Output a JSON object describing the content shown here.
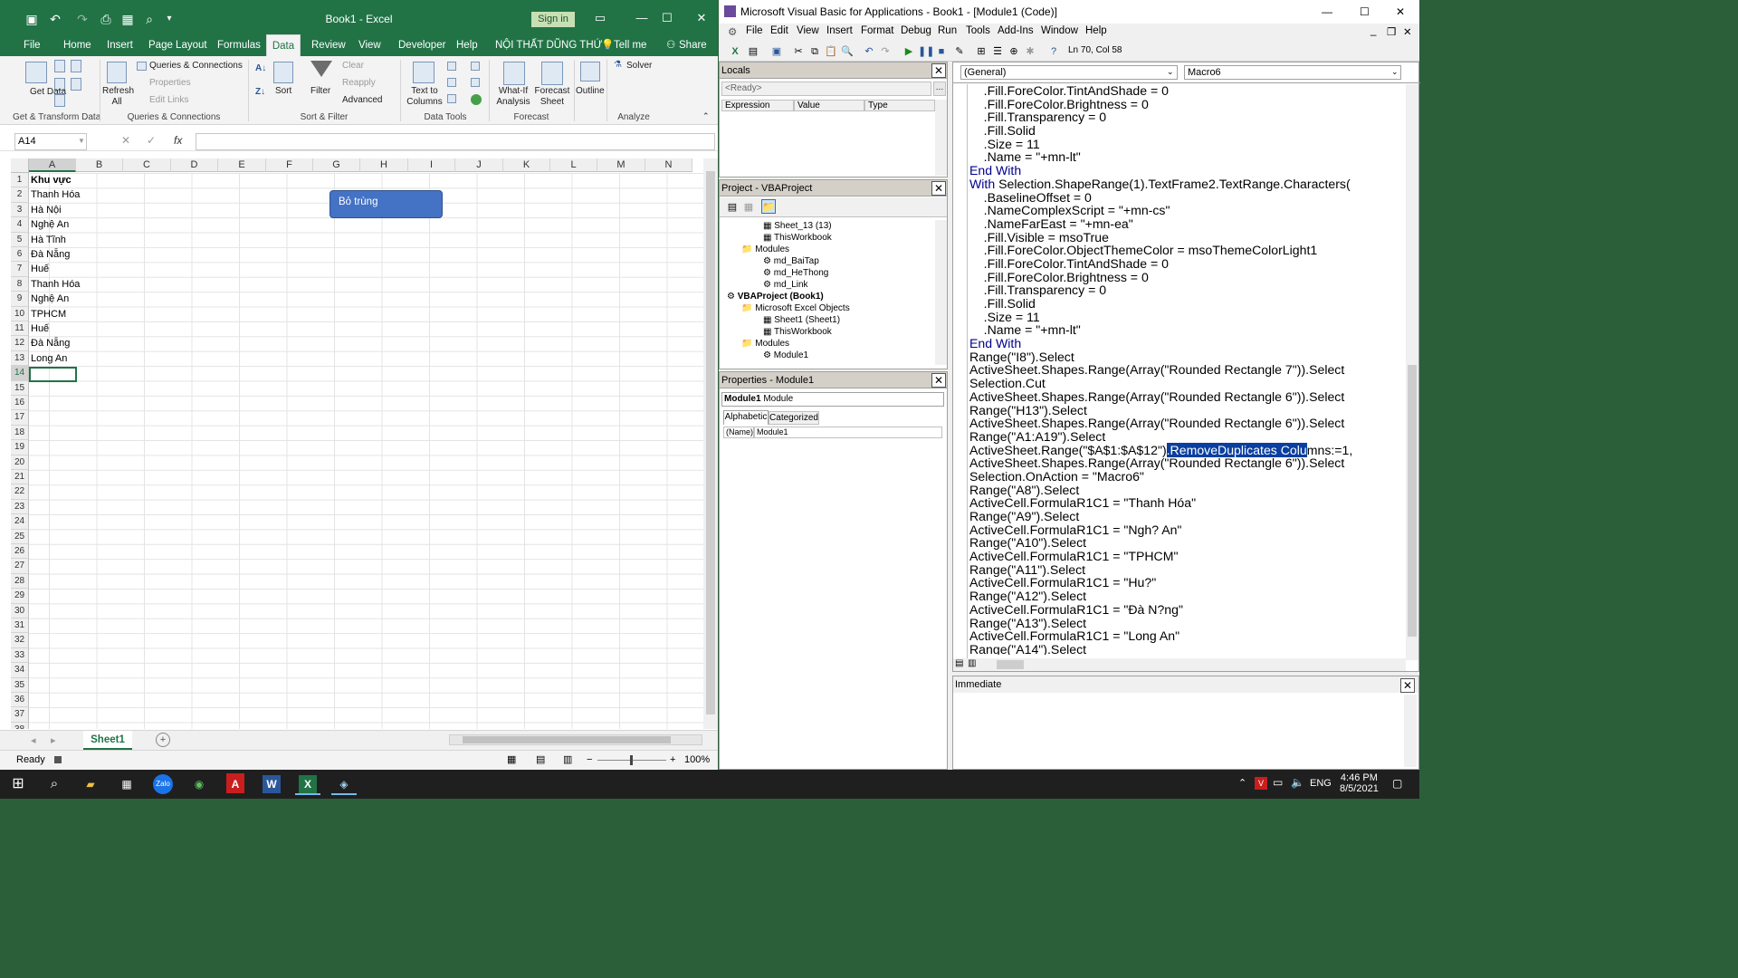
{
  "excel": {
    "title": "Book1  -  Excel",
    "signin": "Sign in",
    "tabs": [
      "File",
      "Home",
      "Insert",
      "Page Layout",
      "Formulas",
      "Data",
      "Review",
      "View",
      "Developer",
      "Help",
      "NỘI THẤT DŨNG THỨ"
    ],
    "tell_me": "Tell me",
    "share": "Share",
    "ribbon": {
      "get_data": "Get Data",
      "get_transform": "Get & Transform Data",
      "queries_connections": "Queries & Connections",
      "properties": "Properties",
      "edit_links": "Edit Links",
      "refresh_all": "Refresh All",
      "qc_group": "Queries & Connections",
      "sort": "Sort",
      "filter": "Filter",
      "clear": "Clear",
      "reapply": "Reapply",
      "advanced": "Advanced",
      "sort_filter": "Sort & Filter",
      "text_to_columns": "Text to Columns",
      "data_tools": "Data Tools",
      "what_if": "What-If Analysis",
      "forecast_sheet": "Forecast Sheet",
      "forecast": "Forecast",
      "outline": "Outline",
      "solver": "Solver",
      "analyze": "Analyze"
    },
    "name_box": "A14",
    "columns": [
      "A",
      "B",
      "C",
      "D",
      "E",
      "F",
      "G",
      "H",
      "I",
      "J",
      "K",
      "L",
      "M",
      "N"
    ],
    "rows": [
      "1",
      "2",
      "3",
      "4",
      "5",
      "6",
      "7",
      "8",
      "9",
      "10",
      "11",
      "12",
      "13",
      "14",
      "15",
      "16",
      "17",
      "18",
      "19",
      "20",
      "21",
      "22",
      "23",
      "24",
      "25",
      "26",
      "27",
      "28",
      "29",
      "30",
      "31",
      "32",
      "33",
      "34",
      "35",
      "36",
      "37",
      "38"
    ],
    "cells": [
      "Khu vực",
      "Thanh Hóa",
      "Hà Nội",
      "Nghệ An",
      "Hà Tĩnh",
      "Đà Nẵng",
      "Huế",
      "Thanh Hóa",
      "Nghệ An",
      "TPHCM",
      "Huế",
      "Đà Nẵng",
      "Long An"
    ],
    "shape_label": "Bỏ trùng",
    "sheet_tab": "Sheet1",
    "status": "Ready",
    "zoom": "100%"
  },
  "vba": {
    "title": "Microsoft Visual Basic for Applications - Book1 - [Module1 (Code)]",
    "menu": [
      "File",
      "Edit",
      "View",
      "Insert",
      "Format",
      "Debug",
      "Run",
      "Tools",
      "Add-Ins",
      "Window",
      "Help"
    ],
    "position": "Ln 70, Col 58",
    "locals_title": "Locals",
    "locals_ready": "<Ready>",
    "locals_cols": [
      "Expression",
      "Value",
      "Type"
    ],
    "project_title": "Project - VBAProject",
    "tree": [
      "Sheet_13 (13)",
      "ThisWorkbook",
      "Modules",
      "md_BaiTap",
      "md_HeThong",
      "md_Link",
      "VBAProject (Book1)",
      "Microsoft Excel Objects",
      "Sheet1 (Sheet1)",
      "ThisWorkbook",
      "Modules",
      "Module1"
    ],
    "props_title": "Properties - Module1",
    "props_object": "Module1",
    "props_object_type": "Module",
    "props_tabs": [
      "Alphabetic",
      "Categorized"
    ],
    "props_row": {
      "name": "(Name)",
      "value": "Module1"
    },
    "general": "(General)",
    "proc": "Macro6",
    "code": [
      {
        "i": 2,
        "t": ".Fill.ForeColor.TintAndShade = 0"
      },
      {
        "i": 2,
        "t": ".Fill.ForeColor.Brightness = 0"
      },
      {
        "i": 2,
        "t": ".Fill.Transparency = 0"
      },
      {
        "i": 2,
        "t": ".Fill.Solid"
      },
      {
        "i": 2,
        "t": ".Size = 11"
      },
      {
        "i": 2,
        "t": ".Name = \"+mn-lt\""
      },
      {
        "i": 1,
        "k": "End With",
        "t": ""
      },
      {
        "i": 1,
        "k": "With",
        "t": " Selection.ShapeRange(1).TextFrame2.TextRange.Characters("
      },
      {
        "i": 2,
        "t": ".BaselineOffset = 0"
      },
      {
        "i": 2,
        "t": ".NameComplexScript = \"+mn-cs\""
      },
      {
        "i": 2,
        "t": ".NameFarEast = \"+mn-ea\""
      },
      {
        "i": 2,
        "t": ".Fill.Visible = msoTrue"
      },
      {
        "i": 2,
        "t": ".Fill.ForeColor.ObjectThemeColor = msoThemeColorLight1"
      },
      {
        "i": 2,
        "t": ".Fill.ForeColor.TintAndShade = 0"
      },
      {
        "i": 2,
        "t": ".Fill.ForeColor.Brightness = 0"
      },
      {
        "i": 2,
        "t": ".Fill.Transparency = 0"
      },
      {
        "i": 2,
        "t": ".Fill.Solid"
      },
      {
        "i": 2,
        "t": ".Size = 11"
      },
      {
        "i": 2,
        "t": ".Name = \"+mn-lt\""
      },
      {
        "i": 1,
        "k": "End With",
        "t": ""
      },
      {
        "i": 1,
        "t": "Range(\"I8\").Select"
      },
      {
        "i": 1,
        "t": "ActiveSheet.Shapes.Range(Array(\"Rounded Rectangle 7\")).Select"
      },
      {
        "i": 1,
        "t": "Selection.Cut"
      },
      {
        "i": 1,
        "t": "ActiveSheet.Shapes.Range(Array(\"Rounded Rectangle 6\")).Select"
      },
      {
        "i": 1,
        "t": "Range(\"H13\").Select"
      },
      {
        "i": 1,
        "t": "ActiveSheet.Shapes.Range(Array(\"Rounded Rectangle 6\")).Select"
      },
      {
        "i": 1,
        "t": "Range(\"A1:A19\").Select"
      },
      {
        "i": 1,
        "t": "ActiveSheet.Range(\"$A$1:$A$12\")",
        "h": ".RemoveDuplicates Colu",
        "a": "mns:=1,"
      },
      {
        "i": 1,
        "t": "ActiveSheet.Shapes.Range(Array(\"Rounded Rectangle 6\")).Select"
      },
      {
        "i": 1,
        "t": "Selection.OnAction = \"Macro6\""
      },
      {
        "i": 1,
        "t": "Range(\"A8\").Select"
      },
      {
        "i": 1,
        "t": "ActiveCell.FormulaR1C1 = \"Thanh Hóa\""
      },
      {
        "i": 1,
        "t": "Range(\"A9\").Select"
      },
      {
        "i": 1,
        "t": "ActiveCell.FormulaR1C1 = \"Ngh? An\""
      },
      {
        "i": 1,
        "t": "Range(\"A10\").Select"
      },
      {
        "i": 1,
        "t": "ActiveCell.FormulaR1C1 = \"TPHCM\""
      },
      {
        "i": 1,
        "t": "Range(\"A11\").Select"
      },
      {
        "i": 1,
        "t": "ActiveCell.FormulaR1C1 = \"Hu?\""
      },
      {
        "i": 1,
        "t": "Range(\"A12\").Select"
      },
      {
        "i": 1,
        "t": "ActiveCell.FormulaR1C1 = \"Ðà N?ng\""
      },
      {
        "i": 1,
        "t": "Range(\"A13\").Select"
      },
      {
        "i": 1,
        "t": "ActiveCell.FormulaR1C1 = \"Long An\""
      },
      {
        "i": 1,
        "t": "Range(\"A14\").Select"
      }
    ],
    "immediate_title": "Immediate"
  },
  "taskbar": {
    "lang": "ENG",
    "time": "4:46 PM",
    "date": "8/5/2021",
    "zalo": "Zalo"
  },
  "colors": {
    "excel_green": "#217346",
    "shape_blue": "#4472c4",
    "code_keyword": "#00008b",
    "selection": "#0a3fa0"
  }
}
